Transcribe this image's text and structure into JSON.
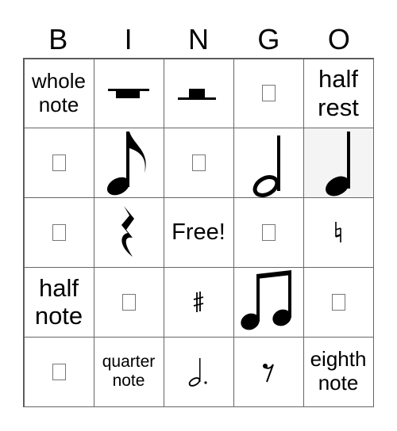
{
  "header": [
    "B",
    "I",
    "N",
    "G",
    "O"
  ],
  "cells": [
    {
      "type": "text",
      "text": "whole note",
      "size": 26
    },
    {
      "type": "icon",
      "icon": "whole-rest-icon"
    },
    {
      "type": "icon",
      "icon": "half-rest-symbol-icon"
    },
    {
      "type": "missing",
      "icon": "missing-glyph-icon"
    },
    {
      "type": "text",
      "text": "half rest",
      "size": 31
    },
    {
      "type": "missing",
      "icon": "missing-glyph-icon"
    },
    {
      "type": "icon",
      "icon": "eighth-note-icon"
    },
    {
      "type": "missing",
      "icon": "missing-glyph-icon"
    },
    {
      "type": "icon",
      "icon": "half-note-icon"
    },
    {
      "type": "icon",
      "icon": "quarter-note-icon"
    },
    {
      "type": "missing",
      "icon": "missing-glyph-icon"
    },
    {
      "type": "icon",
      "icon": "quarter-rest-icon"
    },
    {
      "type": "text",
      "text": "Free!",
      "size": 29
    },
    {
      "type": "missing",
      "icon": "missing-glyph-icon"
    },
    {
      "type": "icon",
      "icon": "natural-sign-icon"
    },
    {
      "type": "text",
      "text": "half note",
      "size": 31
    },
    {
      "type": "missing",
      "icon": "missing-glyph-icon"
    },
    {
      "type": "icon",
      "icon": "sharp-sign-icon"
    },
    {
      "type": "icon",
      "icon": "beamed-eighth-notes-icon"
    },
    {
      "type": "missing",
      "icon": "missing-glyph-icon"
    },
    {
      "type": "missing",
      "icon": "missing-glyph-icon"
    },
    {
      "type": "text",
      "text": "quarter note",
      "size": 21
    },
    {
      "type": "icon",
      "icon": "dotted-half-note-icon"
    },
    {
      "type": "icon",
      "icon": "eighth-rest-icon"
    },
    {
      "type": "text",
      "text": "eighth note",
      "size": 26
    }
  ]
}
